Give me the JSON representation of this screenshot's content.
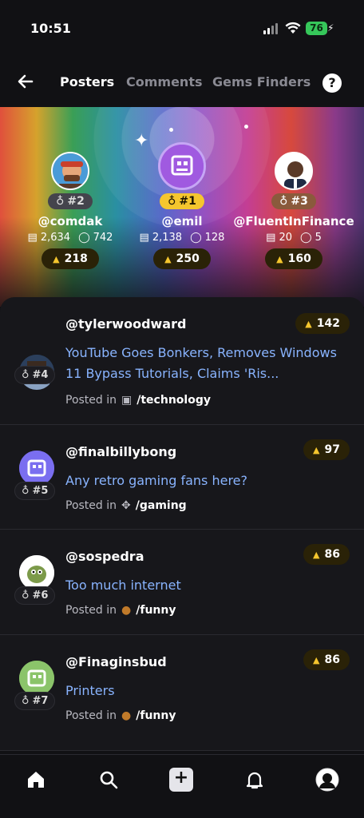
{
  "status": {
    "time": "10:51",
    "battery": "76"
  },
  "nav": {
    "tabs": [
      "Posters",
      "Comments",
      "Gems Finders"
    ],
    "help": "?"
  },
  "podium": [
    {
      "rank": "#2",
      "handle": "@comdak",
      "posts": "2,634",
      "comments": "742",
      "score": "218"
    },
    {
      "rank": "#1",
      "handle": "@emil",
      "posts": "2,138",
      "comments": "128",
      "score": "250"
    },
    {
      "rank": "#3",
      "handle": "@FluentInFinance",
      "posts": "20",
      "comments": "5",
      "score": "160"
    }
  ],
  "feed": [
    {
      "user": "@tylerwoodward",
      "rank": "#4",
      "title": "YouTube Goes Bonkers, Removes Windows 11 Bypass Tutorials, Claims 'Ris...",
      "posted_label": "Posted in",
      "community": "/technology",
      "score": "142"
    },
    {
      "user": "@finalbillybong",
      "rank": "#5",
      "title": "Any retro gaming fans here?",
      "posted_label": "Posted in",
      "community": "/gaming",
      "score": "97"
    },
    {
      "user": "@sospedra",
      "rank": "#6",
      "title": "Too much internet",
      "posted_label": "Posted in",
      "community": "/funny",
      "score": "86"
    },
    {
      "user": "@Finaginsbud",
      "rank": "#7",
      "title": "Printers",
      "posted_label": "Posted in",
      "community": "/funny",
      "score": "86"
    }
  ],
  "tabbar": {
    "items": [
      "home-icon",
      "search-icon",
      "plus-icon",
      "bell-icon",
      "profile-avatar"
    ]
  },
  "colors": {
    "link": "#89b4ff",
    "gold": "#f5c62e",
    "background": "#111114"
  }
}
